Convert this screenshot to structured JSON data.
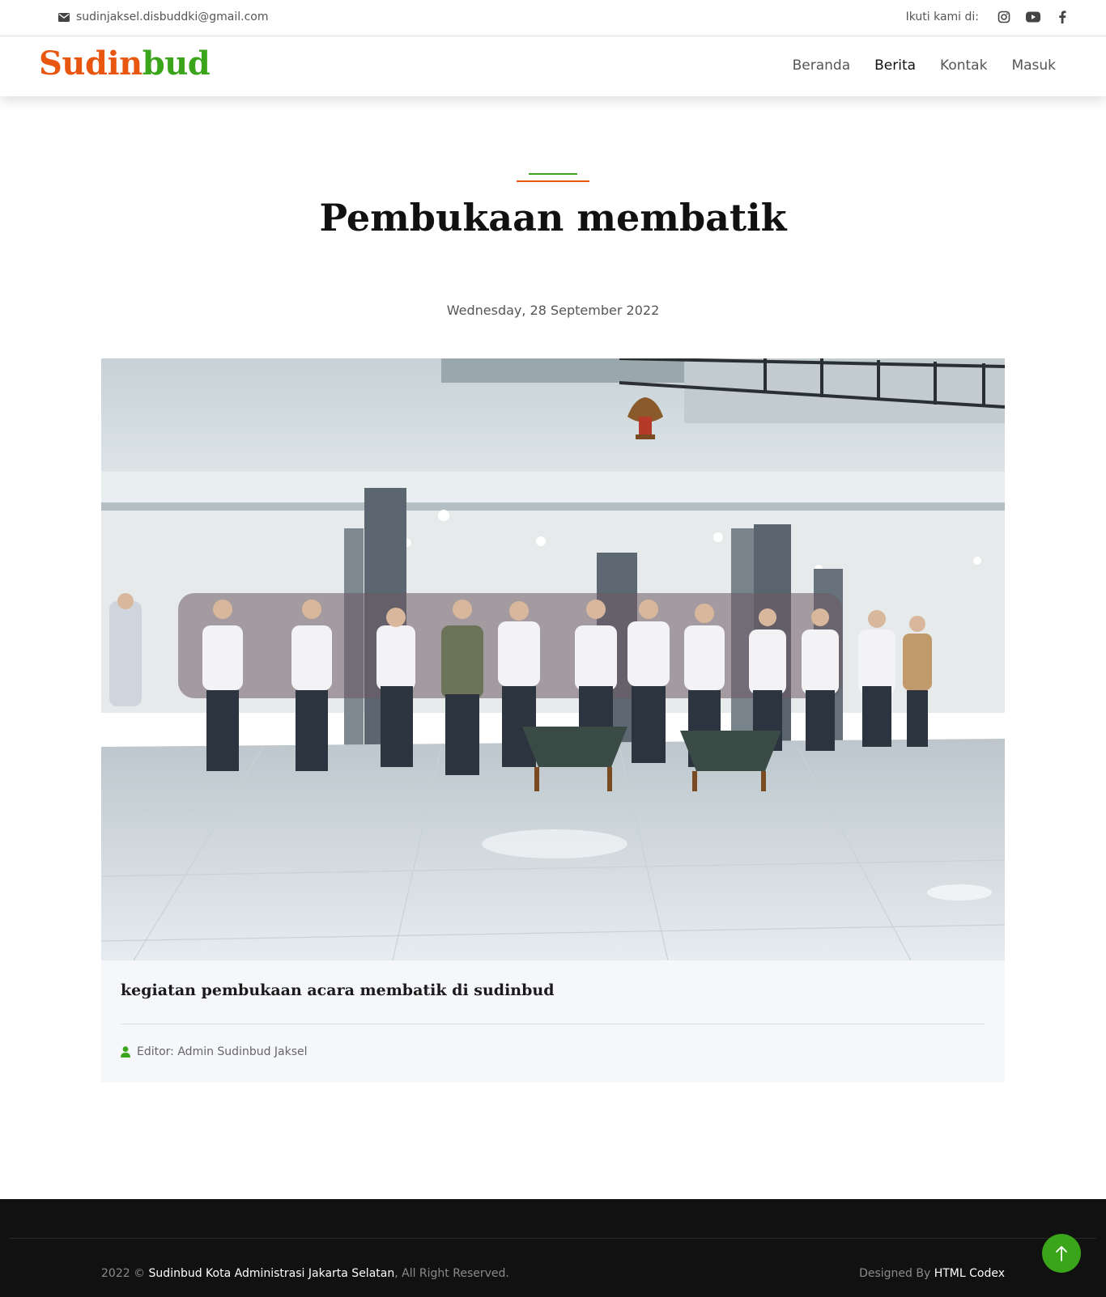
{
  "topbar": {
    "email": "sudinjaksel.disbuddki@gmail.com",
    "follow_label": "Ikuti kami di:",
    "social": [
      "instagram-icon",
      "youtube-icon",
      "facebook-icon"
    ]
  },
  "brand": {
    "part1": "Sudin",
    "part2": "bud"
  },
  "nav": {
    "items": [
      "Beranda",
      "Berita",
      "Kontak",
      "Masuk"
    ],
    "active": "Berita"
  },
  "article": {
    "title": "Pembukaan membatik",
    "date": "Wednesday, 28 September 2022",
    "caption": "kegiatan pembukaan acara membatik di sudinbud",
    "editor": "Editor: Admin Sudinbud Jaksel"
  },
  "footer": {
    "year": "2022 ©",
    "org": "Sudinbud Kota Administrasi Jakarta Selatan",
    "rights": ", All Right Reserved.",
    "designed_by": "Designed By",
    "designer": "HTML Codex"
  },
  "colors": {
    "orange": "#e8560f",
    "green": "#3aa51a",
    "footer_bg": "#111111",
    "card_bg": "#f5f7fa"
  }
}
